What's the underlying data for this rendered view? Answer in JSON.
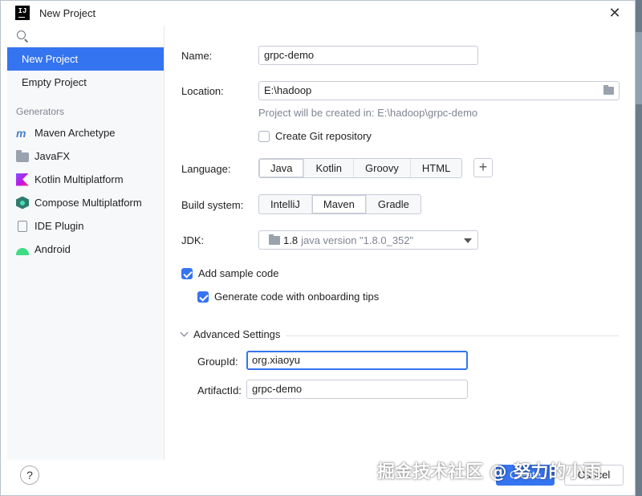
{
  "window": {
    "title": "New Project"
  },
  "sidebar": {
    "search_placeholder": "",
    "items": [
      {
        "label": "New Project",
        "selected": true
      },
      {
        "label": "Empty Project",
        "selected": false
      }
    ],
    "generators_label": "Generators",
    "generators": [
      {
        "label": "Maven Archetype",
        "icon": "maven-icon"
      },
      {
        "label": "JavaFX",
        "icon": "javafx-icon"
      },
      {
        "label": "Kotlin Multiplatform",
        "icon": "kotlin-icon"
      },
      {
        "label": "Compose Multiplatform",
        "icon": "compose-icon"
      },
      {
        "label": "IDE Plugin",
        "icon": "plugin-icon"
      },
      {
        "label": "Android",
        "icon": "android-icon"
      }
    ]
  },
  "form": {
    "name_label": "Name:",
    "name_value": "grpc-demo",
    "location_label": "Location:",
    "location_value": "E:\\hadoop",
    "location_hint": "Project will be created in: E:\\hadoop\\grpc-demo",
    "git_label": "Create Git repository",
    "git_checked": false,
    "language_label": "Language:",
    "languages": [
      "Java",
      "Kotlin",
      "Groovy",
      "HTML"
    ],
    "language_selected": "Java",
    "add_language_symbol": "+",
    "build_label": "Build system:",
    "build_systems": [
      "IntelliJ",
      "Maven",
      "Gradle"
    ],
    "build_selected": "Maven",
    "jdk_label": "JDK:",
    "jdk_version": "1.8",
    "jdk_desc": "java version \"1.8.0_352\"",
    "sample_code_label": "Add sample code",
    "sample_code_checked": true,
    "onboarding_label": "Generate code with onboarding tips",
    "onboarding_checked": true,
    "advanced_label": "Advanced Settings",
    "groupid_label": "GroupId:",
    "groupid_value": "org.xiaoyu",
    "artifactid_label": "ArtifactId:",
    "artifactid_value": "grpc-demo"
  },
  "footer": {
    "help_symbol": "?",
    "create_label": "Create",
    "cancel_label": "Cancel"
  },
  "watermark": "掘金技术社区 @ 努力的小雨",
  "colors": {
    "accent": "#3574f0",
    "sidebar_bg": "#f7f8fa",
    "hint": "#818594"
  }
}
